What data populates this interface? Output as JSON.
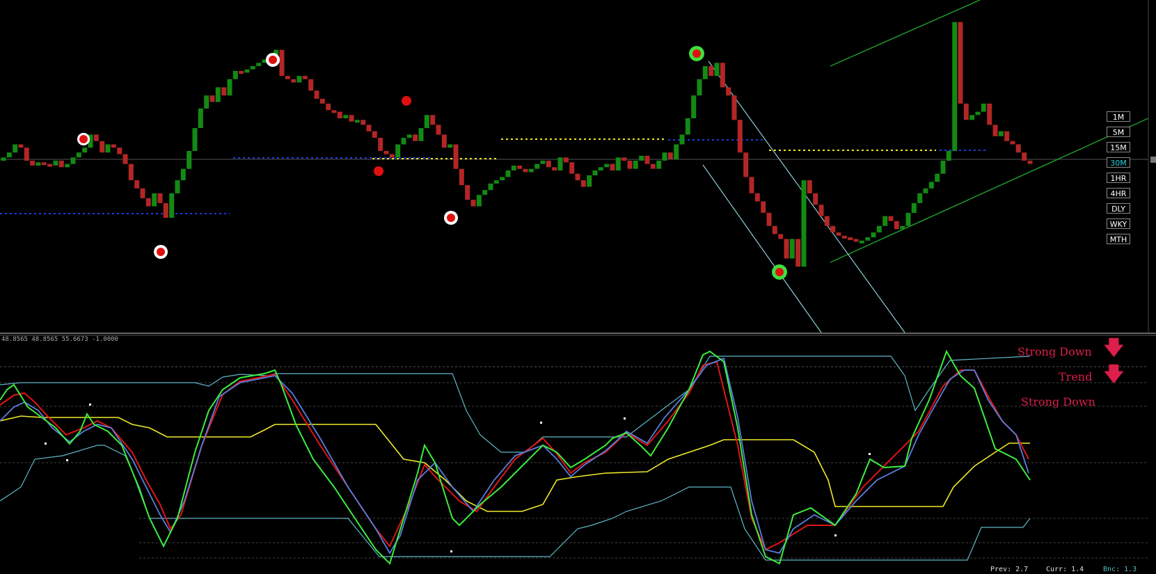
{
  "timeframes": {
    "items": [
      {
        "label": "1M",
        "top": 0
      },
      {
        "label": "5M"
      },
      {
        "label": "15M"
      },
      {
        "label": "30M",
        "active": true
      },
      {
        "label": "1HR"
      },
      {
        "label": "4HR"
      },
      {
        "label": "DLY"
      },
      {
        "label": "WKY"
      },
      {
        "label": "MTH"
      }
    ]
  },
  "oscillator": {
    "header": "48.8565 48.8565 55.6673 -1.0000"
  },
  "signals": {
    "line1": "Strong Down",
    "line2": "Trend",
    "line3": "Strong Down"
  },
  "footer": {
    "prev": "Prev: 2.7",
    "curr": "Curr: 1.4",
    "bnc": "Bnc: 1.3"
  },
  "colors": {
    "bull": "#138a13",
    "bear": "#b32626",
    "signal_red": "#dc1e4b",
    "osc_green": "#3cee3c",
    "osc_red": "#e01515",
    "osc_blue": "#5a7ee0",
    "osc_yellow": "#f0ea28",
    "band_cyan": "#5fb8c8",
    "channel_green": "#1f9a2a",
    "channel_cyan": "#8fd0d8"
  },
  "chart_data": {
    "type": "bar",
    "candle_closes": [
      0.52,
      0.55,
      0.6,
      0.58,
      0.5,
      0.47,
      0.49,
      0.48,
      0.47,
      0.5,
      0.46,
      0.48,
      0.52,
      0.55,
      0.58,
      0.66,
      0.62,
      0.55,
      0.6,
      0.58,
      0.54,
      0.48,
      0.38,
      0.33,
      0.27,
      0.22,
      0.3,
      0.24,
      0.15,
      0.3,
      0.38,
      0.45,
      0.56,
      0.7,
      0.82,
      0.9,
      0.86,
      0.95,
      0.9,
      1.0,
      1.05,
      1.04,
      1.06,
      1.08,
      1.1,
      1.12,
      1.15,
      1.18,
      1.02,
      1.0,
      0.98,
      1.02,
      1.0,
      0.93,
      0.88,
      0.85,
      0.81,
      0.8,
      0.76,
      0.78,
      0.74,
      0.75,
      0.72,
      0.68,
      0.64,
      0.56,
      0.54,
      0.52,
      0.6,
      0.64,
      0.66,
      0.62,
      0.7,
      0.78,
      0.72,
      0.66,
      0.58,
      0.6,
      0.45,
      0.35,
      0.26,
      0.22,
      0.29,
      0.32,
      0.36,
      0.38,
      0.4,
      0.44,
      0.47,
      0.45,
      0.43,
      0.45,
      0.48,
      0.5,
      0.46,
      0.44,
      0.52,
      0.49,
      0.42,
      0.38,
      0.34,
      0.41,
      0.44,
      0.46,
      0.48,
      0.44,
      0.52,
      0.5,
      0.45,
      0.5,
      0.53,
      0.48,
      0.45,
      0.5,
      0.55,
      0.51,
      0.6,
      0.66,
      0.76,
      0.9,
      1.0,
      1.08,
      1.02,
      1.1,
      0.95,
      0.9,
      0.75,
      0.55,
      0.4,
      0.3,
      0.25,
      0.18,
      0.1,
      0.05,
      0.02,
      -0.1,
      0.02,
      -0.15,
      0.38,
      0.3,
      0.23,
      0.16,
      0.1,
      0.06,
      0.04,
      0.03,
      0.02,
      0.01,
      0.01,
      0.03,
      0.06,
      0.1,
      0.16,
      0.13,
      0.08,
      0.1,
      0.18,
      0.24,
      0.3,
      0.33,
      0.37,
      0.42,
      0.5,
      0.56,
      1.35,
      0.85,
      0.75,
      0.78,
      0.8,
      0.85,
      0.72,
      0.65,
      0.68,
      0.62,
      0.6,
      0.55,
      0.5,
      0.48
    ]
  }
}
